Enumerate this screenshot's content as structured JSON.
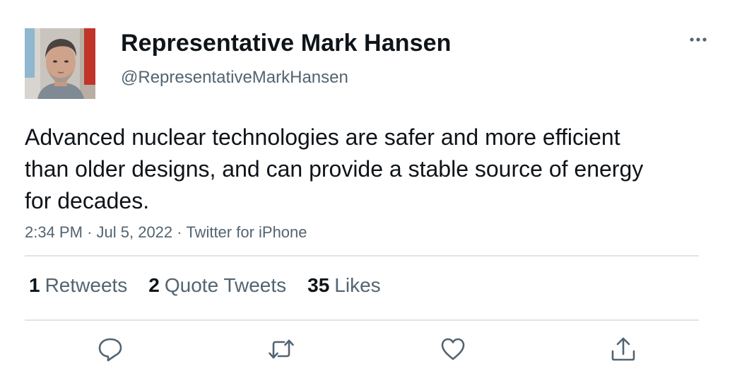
{
  "author": {
    "display_name": "Representative Mark Hansen",
    "handle": "@RepresentativeMarkHansen",
    "avatar_icon": "profile-photo"
  },
  "tweet": {
    "text": "Advanced nuclear technologies are safer and more efficient than older designs, and can provide a stable source of energy for decades.",
    "time": "2:34 PM",
    "date": "Jul 5, 2022",
    "source": "Twitter for iPhone",
    "separator": "·"
  },
  "stats": {
    "retweets_count": "1",
    "retweets_label": "Retweets",
    "quotes_count": "2",
    "quotes_label": "Quote Tweets",
    "likes_count": "35",
    "likes_label": "Likes"
  },
  "actions": {
    "icons": [
      "reply-icon",
      "retweet-icon",
      "like-icon",
      "share-icon"
    ]
  },
  "colors": {
    "text_primary": "#0f1419",
    "text_secondary": "#536471",
    "divider": "#e1e4e6",
    "icon": "#536471"
  }
}
